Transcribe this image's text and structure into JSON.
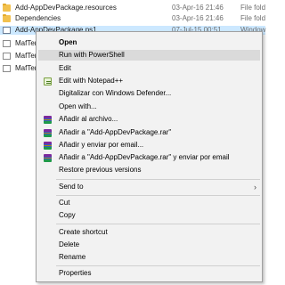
{
  "files": [
    {
      "name": "Add-AppDevPackage.resources",
      "date": "03-Apr-16 21:46",
      "type": "File fold",
      "icon": "folder-icon",
      "selected": false
    },
    {
      "name": "Dependencies",
      "date": "03-Apr-16 21:46",
      "type": "File fold",
      "icon": "folder-icon",
      "selected": false
    },
    {
      "name": "Add-AppDevPackage.ps1",
      "date": "07-Jul-15 00:51",
      "type": "Window",
      "icon": "script-icon",
      "selected": true
    },
    {
      "name": "MafTem",
      "icon": "doc-icon"
    },
    {
      "name": "MafTem",
      "icon": "doc-icon"
    },
    {
      "name": "MafTem",
      "icon": "doc-icon"
    }
  ],
  "menu": {
    "open": "Open",
    "run_powershell": "Run with PowerShell",
    "edit": "Edit",
    "edit_notepad": "Edit with Notepad++",
    "defender": "Digitalizar con Windows Defender...",
    "open_with": "Open with...",
    "rar_add": "Añadir al archivo...",
    "rar_add_named": "Añadir a \"Add-AppDevPackage.rar\"",
    "rar_email": "Añadir y enviar por email...",
    "rar_named_email": "Añadir a \"Add-AppDevPackage.rar\" y enviar por email",
    "restore": "Restore previous versions",
    "send_to": "Send to",
    "cut": "Cut",
    "copy": "Copy",
    "create_shortcut": "Create shortcut",
    "delete": "Delete",
    "rename": "Rename",
    "properties": "Properties"
  },
  "colors": {
    "selection": "#cce8ff",
    "menu_bg": "#f2f2f2",
    "menu_highlight": "#dadada"
  }
}
